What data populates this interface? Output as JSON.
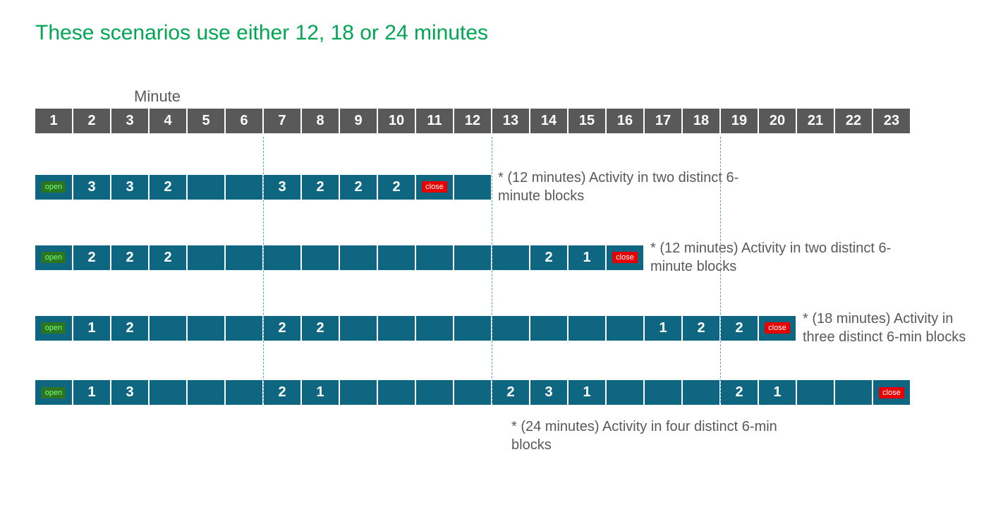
{
  "title": "These scenarios use either 12, 18 or 24 minutes",
  "minute_label": "Minute",
  "chart_data": {
    "type": "table",
    "header_start": 1,
    "header_end": 23,
    "dividers_after": [
      6,
      12,
      18
    ],
    "scenarios": [
      {
        "length": 12,
        "cells": [
          "open",
          "3",
          "3",
          "2",
          "",
          "",
          "3",
          "2",
          "2",
          "2",
          "close",
          ""
        ],
        "caption": "* (12 minutes) Activity in two distinct 6-minute blocks"
      },
      {
        "length": 16,
        "cells": [
          "open",
          "2",
          "2",
          "2",
          "",
          "",
          "",
          "",
          "",
          "",
          "",
          "",
          "",
          "2",
          "1",
          "close"
        ],
        "caption": "* (12 minutes) Activity in two distinct 6-minute blocks"
      },
      {
        "length": 20,
        "cells": [
          "open",
          "1",
          "2",
          "",
          "",
          "",
          "2",
          "2",
          "",
          "",
          "",
          "",
          "",
          "",
          "",
          "",
          "1",
          "2",
          "2",
          "close"
        ],
        "caption": "* (18 minutes) Activity in three distinct 6-min blocks"
      },
      {
        "length": 23,
        "cells": [
          "open",
          "1",
          "3",
          "",
          "",
          "",
          "2",
          "1",
          "",
          "",
          "",
          "",
          "2",
          "3",
          "1",
          "",
          "",
          "",
          "2",
          "1",
          "",
          "",
          "close"
        ],
        "caption": "* (24 minutes) Activity in four distinct 6-min blocks",
        "caption_below": true
      }
    ]
  },
  "badges": {
    "open": "open",
    "close": "close"
  }
}
